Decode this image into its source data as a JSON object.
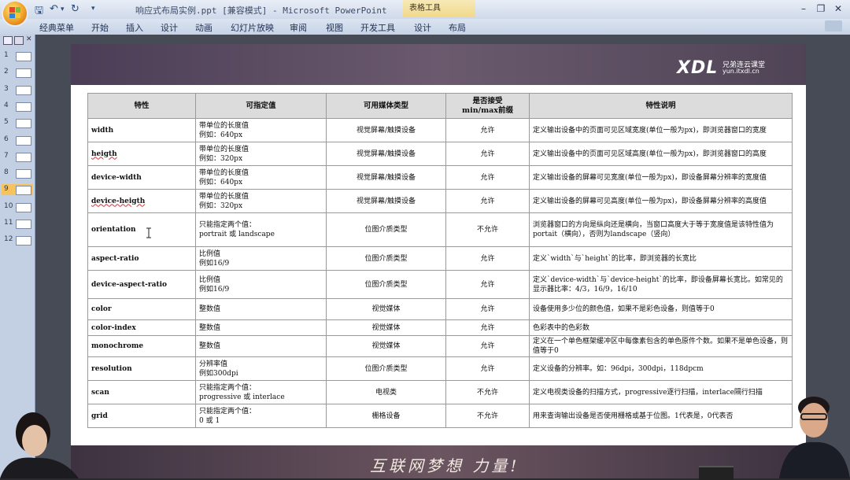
{
  "window": {
    "title": "响应式布局实例.ppt [兼容模式] - Microsoft PowerPoint",
    "contextual_tab": "表格工具"
  },
  "ribbon": {
    "tabs": [
      "经典菜单",
      "开始",
      "插入",
      "设计",
      "动画",
      "幻灯片放映",
      "审阅",
      "视图",
      "开发工具",
      "设计",
      "布局"
    ]
  },
  "thumbnails": {
    "items": [
      "1",
      "2",
      "3",
      "4",
      "5",
      "6",
      "7",
      "8",
      "9",
      "10",
      "11",
      "12"
    ],
    "selected": "9"
  },
  "slide": {
    "logo_text": "XDL",
    "logo_cn": "兄弟连云课堂",
    "logo_url": "yun.itxdl.cn",
    "slogan": "互联网梦想 力量!",
    "table": {
      "headers": [
        "特性",
        "可指定值",
        "可用媒体类型",
        "是否接受\nmin/max前缀",
        "特性说明"
      ],
      "rows": [
        [
          "width",
          "带单位的长度值\n例如：640px",
          "视觉屏幕/触摸设备",
          "允许",
          "定义输出设备中的页面可见区域宽度(单位一般为px)，即浏览器窗口的宽度"
        ],
        [
          "heigth",
          "带单位的长度值\n例如：320px",
          "视觉屏幕/触摸设备",
          "允许",
          "定义输出设备中的页面可见区域高度(单位一般为px)，即浏览器窗口的高度"
        ],
        [
          "device-width",
          "带单位的长度值\n例如：640px",
          "视觉屏幕/触摸设备",
          "允许",
          "定义输出设备的屏幕可见宽度(单位一般为px)，即设备屏幕分辨率的宽度值"
        ],
        [
          "device-heigth",
          "带单位的长度值\n例如：320px",
          "视觉屏幕/触摸设备",
          "允许",
          "定义输出设备的屏幕可见高度(单位一般为px)，即设备屏幕分辨率的高度值"
        ],
        [
          "orientation",
          "只能指定两个值：\nportrait 或 landscape",
          "位图介质类型",
          "不允许",
          "浏览器窗口的方向是纵向还是横向，当窗口高度大于等于宽度值是该特性值为portait（横向），否则为landscape（竖向）"
        ],
        [
          "aspect-ratio",
          "比例值\n例如16/9",
          "位图介质类型",
          "允许",
          "定义`width`与`height`的比率，即浏览器的长宽比"
        ],
        [
          "device-aspect-ratio",
          "比例值\n例如16/9",
          "位图介质类型",
          "允许",
          "定义`device-width`与`device-height`的比率，即设备屏幕长宽比。如常见的显示器比率：4/3，16/9，16/10"
        ],
        [
          "color",
          "整数值",
          "视觉媒体",
          "允许",
          "设备使用多少位的颜色值，如果不是彩色设备，则值等于0"
        ],
        [
          "color-index",
          "整数值",
          "视觉媒体",
          "允许",
          "色彩表中的色彩数"
        ],
        [
          "monochrome",
          "整数值",
          "视觉媒体",
          "允许",
          "定义在一个单色框架缓冲区中每像素包含的单色原件个数。如果不是单色设备，则值等于0"
        ],
        [
          "resolution",
          "分辨率值\n例如300dpi",
          "位图介质类型",
          "允许",
          "定义设备的分辨率。如：96dpi，300dpi，118dpcm"
        ],
        [
          "scan",
          "只能指定两个值：\nprogressive 或 interlace",
          "电视类",
          "不允许",
          "定义电视类设备的扫描方式，progressive逐行扫描，interlace隔行扫描"
        ],
        [
          "grid",
          "只能指定两个值：\n0 或 1",
          "栅格设备",
          "不允许",
          "用来查询输出设备是否使用栅格或基于位图。1代表是，0代表否"
        ]
      ]
    }
  },
  "colors": {
    "ribbon_bg": "#c6d3e6",
    "table_header_bg": "#dcdcdc",
    "slide_banner": "#5a4a60",
    "selected_thumb": "#f6c35d"
  }
}
